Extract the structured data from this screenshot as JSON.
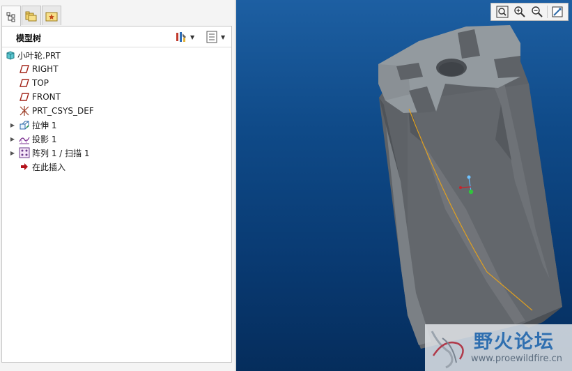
{
  "navigator": {
    "tabs": [
      {
        "name": "model-tree-tab",
        "icon": "tree-icon",
        "active": true
      },
      {
        "name": "folder-browser-tab",
        "icon": "folder-icon",
        "active": false
      },
      {
        "name": "favorites-tab",
        "icon": "favorites-icon",
        "active": false
      }
    ]
  },
  "model_tree": {
    "title": "模型树",
    "settings_icon": "tree-settings-icon",
    "columns_icon": "tree-columns-icon",
    "items": [
      {
        "label": "小叶轮.PRT",
        "icon": "part-icon",
        "expandable": false
      },
      {
        "label": "RIGHT",
        "icon": "datum-plane-icon",
        "expandable": false
      },
      {
        "label": "TOP",
        "icon": "datum-plane-icon",
        "expandable": false
      },
      {
        "label": "FRONT",
        "icon": "datum-plane-icon",
        "expandable": false
      },
      {
        "label": "PRT_CSYS_DEF",
        "icon": "csys-icon",
        "expandable": false
      },
      {
        "label": "拉伸 1",
        "icon": "extrude-icon",
        "expandable": true
      },
      {
        "label": "投影 1",
        "icon": "projection-icon",
        "expandable": true
      },
      {
        "label": "阵列 1 / 扫描 1",
        "icon": "pattern-icon",
        "expandable": true
      },
      {
        "label": "在此插入",
        "icon": "insert-here-arrow-icon",
        "expandable": false
      }
    ]
  },
  "view_toolbar": {
    "buttons": [
      "refit-icon",
      "zoom-in-icon",
      "zoom-out-icon",
      "repaint-icon"
    ]
  },
  "watermark": {
    "title": "野火论坛",
    "url": "www.proewildfire.cn"
  },
  "colors": {
    "viewport_top": "#1d5fa2",
    "viewport_bottom": "#052d5c",
    "model_face": "#8d9297",
    "model_side": "#5d6166",
    "curve": "#e0a020"
  }
}
